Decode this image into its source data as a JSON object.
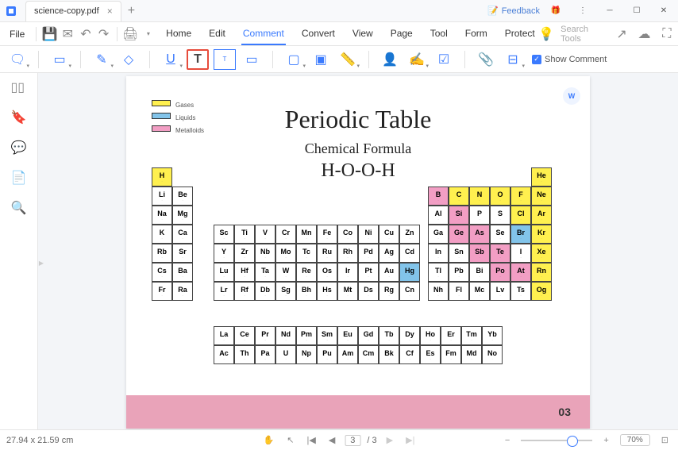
{
  "tab": {
    "name": "science-copy.pdf"
  },
  "feedback": "Feedback",
  "menu": {
    "file": "File",
    "tabs": [
      "Home",
      "Edit",
      "Comment",
      "Convert",
      "View",
      "Page",
      "Tool",
      "Form",
      "Protect"
    ],
    "active": 2,
    "search": "Search Tools"
  },
  "toolbar": {
    "show_comment": "Show Comment"
  },
  "doc": {
    "title": "Periodic Table",
    "subtitle": "Chemical Formula",
    "formula": "H-O-O-H",
    "legend": [
      "Gases",
      "Liquids",
      "Metalloids"
    ],
    "page_num": "03"
  },
  "status": {
    "dims": "27.94 x 21.59 cm",
    "page": "3",
    "total": "/ 3",
    "zoom": "70%"
  },
  "pt": {
    "main": [
      [
        {
          "s": "H",
          "c": "y"
        },
        null,
        null,
        null,
        null,
        null,
        null,
        null,
        null,
        null,
        null,
        null,
        null,
        null,
        null,
        null,
        null,
        {
          "s": "He",
          "c": "y"
        }
      ],
      [
        {
          "s": "Li"
        },
        {
          "s": "Be"
        },
        null,
        null,
        null,
        null,
        null,
        null,
        null,
        null,
        null,
        null,
        {
          "s": "B",
          "c": "p"
        },
        {
          "s": "C",
          "c": "y"
        },
        {
          "s": "N",
          "c": "y"
        },
        {
          "s": "O",
          "c": "y"
        },
        {
          "s": "F",
          "c": "y"
        },
        {
          "s": "Ne",
          "c": "y"
        }
      ],
      [
        {
          "s": "Na"
        },
        {
          "s": "Mg"
        },
        null,
        null,
        null,
        null,
        null,
        null,
        null,
        null,
        null,
        null,
        {
          "s": "Al"
        },
        {
          "s": "Si",
          "c": "p"
        },
        {
          "s": "P"
        },
        {
          "s": "S"
        },
        {
          "s": "Cl",
          "c": "y"
        },
        {
          "s": "Ar",
          "c": "y"
        }
      ],
      [
        {
          "s": "K"
        },
        {
          "s": "Ca"
        },
        {
          "s": "Sc"
        },
        {
          "s": "Ti"
        },
        {
          "s": "V"
        },
        {
          "s": "Cr"
        },
        {
          "s": "Mn"
        },
        {
          "s": "Fe"
        },
        {
          "s": "Co"
        },
        {
          "s": "Ni"
        },
        {
          "s": "Cu"
        },
        {
          "s": "Zn"
        },
        {
          "s": "Ga"
        },
        {
          "s": "Ge",
          "c": "p"
        },
        {
          "s": "As",
          "c": "p"
        },
        {
          "s": "Se"
        },
        {
          "s": "Br",
          "c": "b"
        },
        {
          "s": "Kr",
          "c": "y"
        }
      ],
      [
        {
          "s": "Rb"
        },
        {
          "s": "Sr"
        },
        {
          "s": "Y"
        },
        {
          "s": "Zr"
        },
        {
          "s": "Nb"
        },
        {
          "s": "Mo"
        },
        {
          "s": "Tc"
        },
        {
          "s": "Ru"
        },
        {
          "s": "Rh"
        },
        {
          "s": "Pd"
        },
        {
          "s": "Ag"
        },
        {
          "s": "Cd"
        },
        {
          "s": "In"
        },
        {
          "s": "Sn"
        },
        {
          "s": "Sb",
          "c": "p"
        },
        {
          "s": "Te",
          "c": "p"
        },
        {
          "s": "I"
        },
        {
          "s": "Xe",
          "c": "y"
        }
      ],
      [
        {
          "s": "Cs"
        },
        {
          "s": "Ba"
        },
        {
          "s": "Lu"
        },
        {
          "s": "Hf"
        },
        {
          "s": "Ta"
        },
        {
          "s": "W"
        },
        {
          "s": "Re"
        },
        {
          "s": "Os"
        },
        {
          "s": "Ir"
        },
        {
          "s": "Pt"
        },
        {
          "s": "Au"
        },
        {
          "s": "Hg",
          "c": "b"
        },
        {
          "s": "Tl"
        },
        {
          "s": "Pb"
        },
        {
          "s": "Bi"
        },
        {
          "s": "Po",
          "c": "p"
        },
        {
          "s": "At",
          "c": "p"
        },
        {
          "s": "Rn",
          "c": "y"
        }
      ],
      [
        {
          "s": "Fr"
        },
        {
          "s": "Ra"
        },
        {
          "s": "Lr"
        },
        {
          "s": "Rf"
        },
        {
          "s": "Db"
        },
        {
          "s": "Sg"
        },
        {
          "s": "Bh"
        },
        {
          "s": "Hs"
        },
        {
          "s": "Mt"
        },
        {
          "s": "Ds"
        },
        {
          "s": "Rg"
        },
        {
          "s": "Cn"
        },
        {
          "s": "Nh"
        },
        {
          "s": "Fl"
        },
        {
          "s": "Mc"
        },
        {
          "s": "Lv"
        },
        {
          "s": "Ts"
        },
        {
          "s": "Og",
          "c": "y"
        }
      ]
    ],
    "bottom": [
      [
        "La",
        "Ce",
        "Pr",
        "Nd",
        "Pm",
        "Sm",
        "Eu",
        "Gd",
        "Tb",
        "Dy",
        "Ho",
        "Er",
        "Tm",
        "Yb"
      ],
      [
        "Ac",
        "Th",
        "Pa",
        "U",
        "Np",
        "Pu",
        "Am",
        "Cm",
        "Bk",
        "Cf",
        "Es",
        "Fm",
        "Md",
        "No"
      ]
    ]
  }
}
